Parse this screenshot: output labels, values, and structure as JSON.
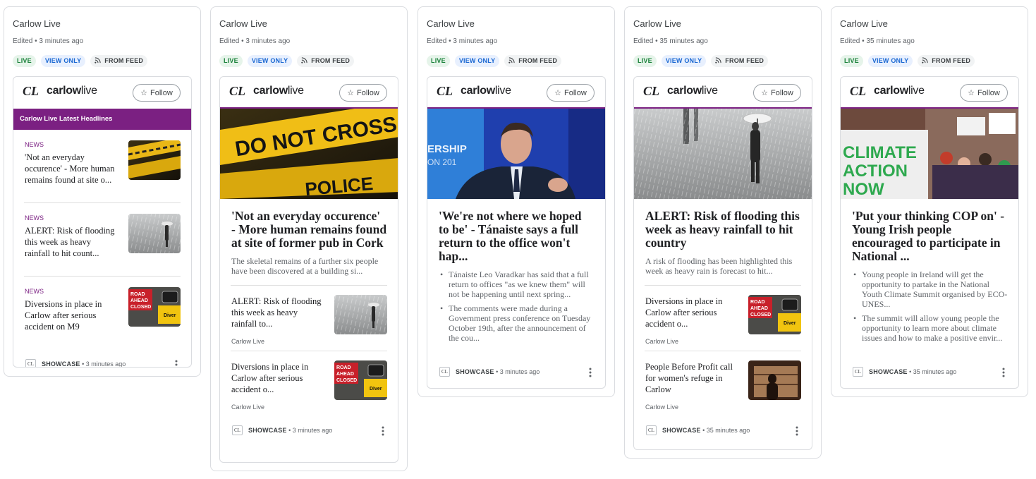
{
  "cards": [
    {
      "outer_title": "Carlow Live",
      "edited": "Edited • 3 minutes ago",
      "badges": [
        "LIVE",
        "VIEW ONLY",
        "FROM FEED"
      ],
      "brand": "carlowlive",
      "follow": "Follow",
      "band": "Carlow Live Latest Headlines",
      "items": [
        {
          "category": "NEWS",
          "title": "'Not an everyday occurence' - More human remains found at site o...",
          "thumb": "police-tape"
        },
        {
          "category": "NEWS",
          "title": "ALERT: Risk of flooding this week as heavy rainfall to hit count...",
          "thumb": "rain"
        },
        {
          "category": "NEWS",
          "title": "Diversions in place in Carlow after serious accident on M9",
          "thumb": "road-closed"
        }
      ],
      "footer": {
        "label": "SHOWCASE",
        "time": "• 3 minutes ago"
      }
    },
    {
      "outer_title": "Carlow Live",
      "edited": "Edited • 3 minutes ago",
      "badges": [
        "LIVE",
        "VIEW ONLY",
        "FROM FEED"
      ],
      "brand": "carlowlive",
      "follow": "Follow",
      "hero_image": "police-tape",
      "hero_title": "'Not an everyday occurence' - More human remains found at site of former pub in Cork",
      "hero_snippet": "The skeletal remains of a further six people have been discovered at a building si...",
      "subs": [
        {
          "title": "ALERT: Risk of flooding this week as heavy rainfall to...",
          "source": "Carlow Live",
          "thumb": "rain"
        },
        {
          "title": "Diversions in place in Carlow after serious accident o...",
          "source": "Carlow Live",
          "thumb": "road-closed"
        }
      ],
      "footer": {
        "label": "SHOWCASE",
        "time": "• 3 minutes ago"
      }
    },
    {
      "outer_title": "Carlow Live",
      "edited": "Edited • 3 minutes ago",
      "badges": [
        "LIVE",
        "VIEW ONLY",
        "FROM FEED"
      ],
      "brand": "carlowlive",
      "follow": "Follow",
      "hero_image": "speaker",
      "hero_title": "'We're not where we hoped to be' - Tánaiste says a full return to the office won't hap...",
      "bullets": [
        "Tánaiste Leo Varadkar has said that a full return to offices \"as we knew them\" will not be happening until next spring...",
        "The comments were made during a Government press conference on Tuesday October 19th, after the announcement of the cou..."
      ],
      "footer": {
        "label": "SHOWCASE",
        "time": "• 3 minutes ago"
      }
    },
    {
      "outer_title": "Carlow Live",
      "edited": "Edited • 35 minutes ago",
      "badges": [
        "LIVE",
        "VIEW ONLY",
        "FROM FEED"
      ],
      "brand": "carlowlive",
      "follow": "Follow",
      "hero_image": "rain",
      "hero_title": "ALERT: Risk of flooding this week as heavy rainfall to hit country",
      "hero_snippet": "A risk of flooding has been highlighted this week as heavy rain is forecast to hit...",
      "subs": [
        {
          "title": "Diversions in place in Carlow after serious accident o...",
          "source": "Carlow Live",
          "thumb": "road-closed"
        },
        {
          "title": "People Before Profit call for women's refuge in Carlow",
          "source": "Carlow Live",
          "thumb": "window"
        }
      ],
      "footer": {
        "label": "SHOWCASE",
        "time": "• 35 minutes ago"
      }
    },
    {
      "outer_title": "Carlow Live",
      "edited": "Edited • 35 minutes ago",
      "badges": [
        "LIVE",
        "VIEW ONLY",
        "FROM FEED"
      ],
      "brand": "carlowlive",
      "follow": "Follow",
      "hero_image": "climate",
      "hero_sign": [
        "CLIMATE",
        "ACTION",
        "NOW"
      ],
      "hero_title": "'Put your thinking COP on' - Young Irish people encouraged to participate in National ...",
      "bullets": [
        "Young people in Ireland will get the opportunity to partake in the National Youth Climate Summit organised by ECO-UNES...",
        "The summit will allow young people the opportunity to learn more about climate issues and how to make a positive envir..."
      ],
      "footer": {
        "label": "SHOWCASE",
        "time": "• 35 minutes ago"
      }
    }
  ],
  "image_text": {
    "road_sign": [
      "ROAD",
      "AHEAD",
      "CLOSED"
    ],
    "diversion": "Diver",
    "tape_large": "DO NOT CROSS",
    "tape_small": "POLICE",
    "podium": [
      "ERSHIP",
      "ON 201"
    ]
  },
  "colors": {
    "brand_purple": "#7b2082",
    "live_green": "#188038",
    "view_blue": "#1967d2"
  },
  "icons": {
    "follow": "star-outline-icon",
    "feed": "rss-icon",
    "menu": "more-vert-icon",
    "source_logo": "carlowlive-logo-icon"
  }
}
